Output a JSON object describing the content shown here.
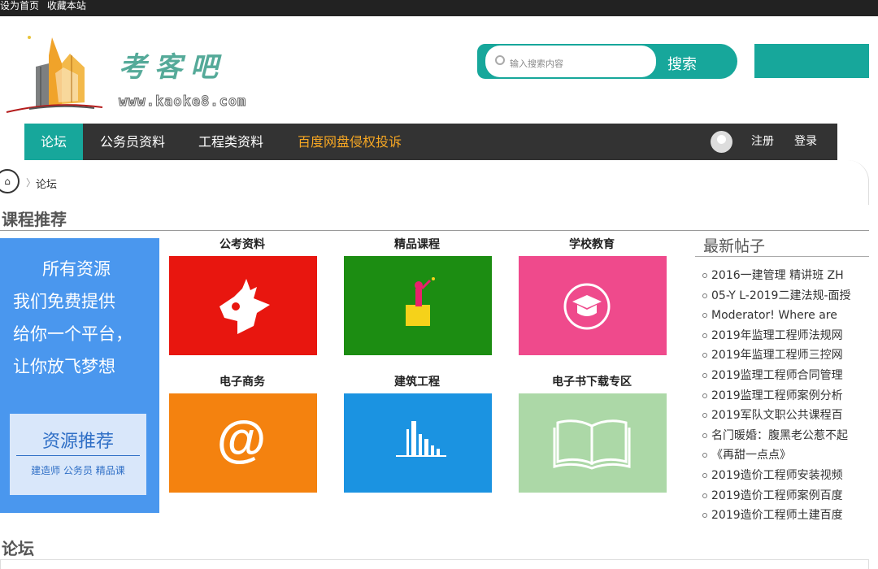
{
  "topbar": {
    "links": [
      "设为首页",
      "收藏本站"
    ]
  },
  "logo": {
    "text": "考客吧",
    "url": "www.kaoke8.com"
  },
  "search": {
    "placeholder": "输入搜索内容",
    "button": "搜索"
  },
  "colors": {
    "teal": "#17a79b",
    "dark": "#333333",
    "orange": "#f5a623",
    "blue": "#4a97ee"
  },
  "nav": {
    "items": [
      "论坛",
      "公务员资料",
      "工程类资料",
      "百度网盘侵权投诉"
    ],
    "active": "论坛",
    "register": "注册",
    "login": "登录"
  },
  "breadcrumb": {
    "current": "论坛"
  },
  "courses": {
    "title": "课程推荐",
    "promo": {
      "lines": [
        "所有资源",
        "我们免费提供",
        "给你一个平台，",
        "让你放飞梦想"
      ],
      "card_title": "资源推荐",
      "card_sub": "建造师 公务员 精品课"
    },
    "tiles": [
      {
        "label": "公考资料",
        "color": "#e8160f",
        "icon": "crest-icon"
      },
      {
        "label": "精品课程",
        "color": "#1c8d12",
        "icon": "reading-figure-icon"
      },
      {
        "label": "学校教育",
        "color": "#ef4a8c",
        "icon": "graduation-cap-icon"
      },
      {
        "label": "电子商务",
        "color": "#f4820f",
        "icon": "at-sign-icon"
      },
      {
        "label": "建筑工程",
        "color": "#1b93e1",
        "icon": "buildings-icon"
      },
      {
        "label": "电子书下载专区",
        "color": "#acd8a7",
        "icon": "open-book-icon"
      }
    ]
  },
  "latest": {
    "title": "最新帖子",
    "posts": [
      "2016一建管理 精讲班 ZH",
      "05-Y L-2019二建法规-面授",
      "Moderator! Where are",
      "2019年监理工程师法规网",
      "2019年监理工程师三控网",
      "2019监理工程师合同管理",
      "2019监理工程师案例分析",
      "2019军队文职公共课程百",
      "名门暖婚：腹黑老公惹不起",
      "《再甜一点点》",
      "2019造价工程师安装视频",
      "2019造价工程师案例百度",
      "2019造价工程师土建百度"
    ]
  },
  "forum": {
    "title": "论坛"
  }
}
